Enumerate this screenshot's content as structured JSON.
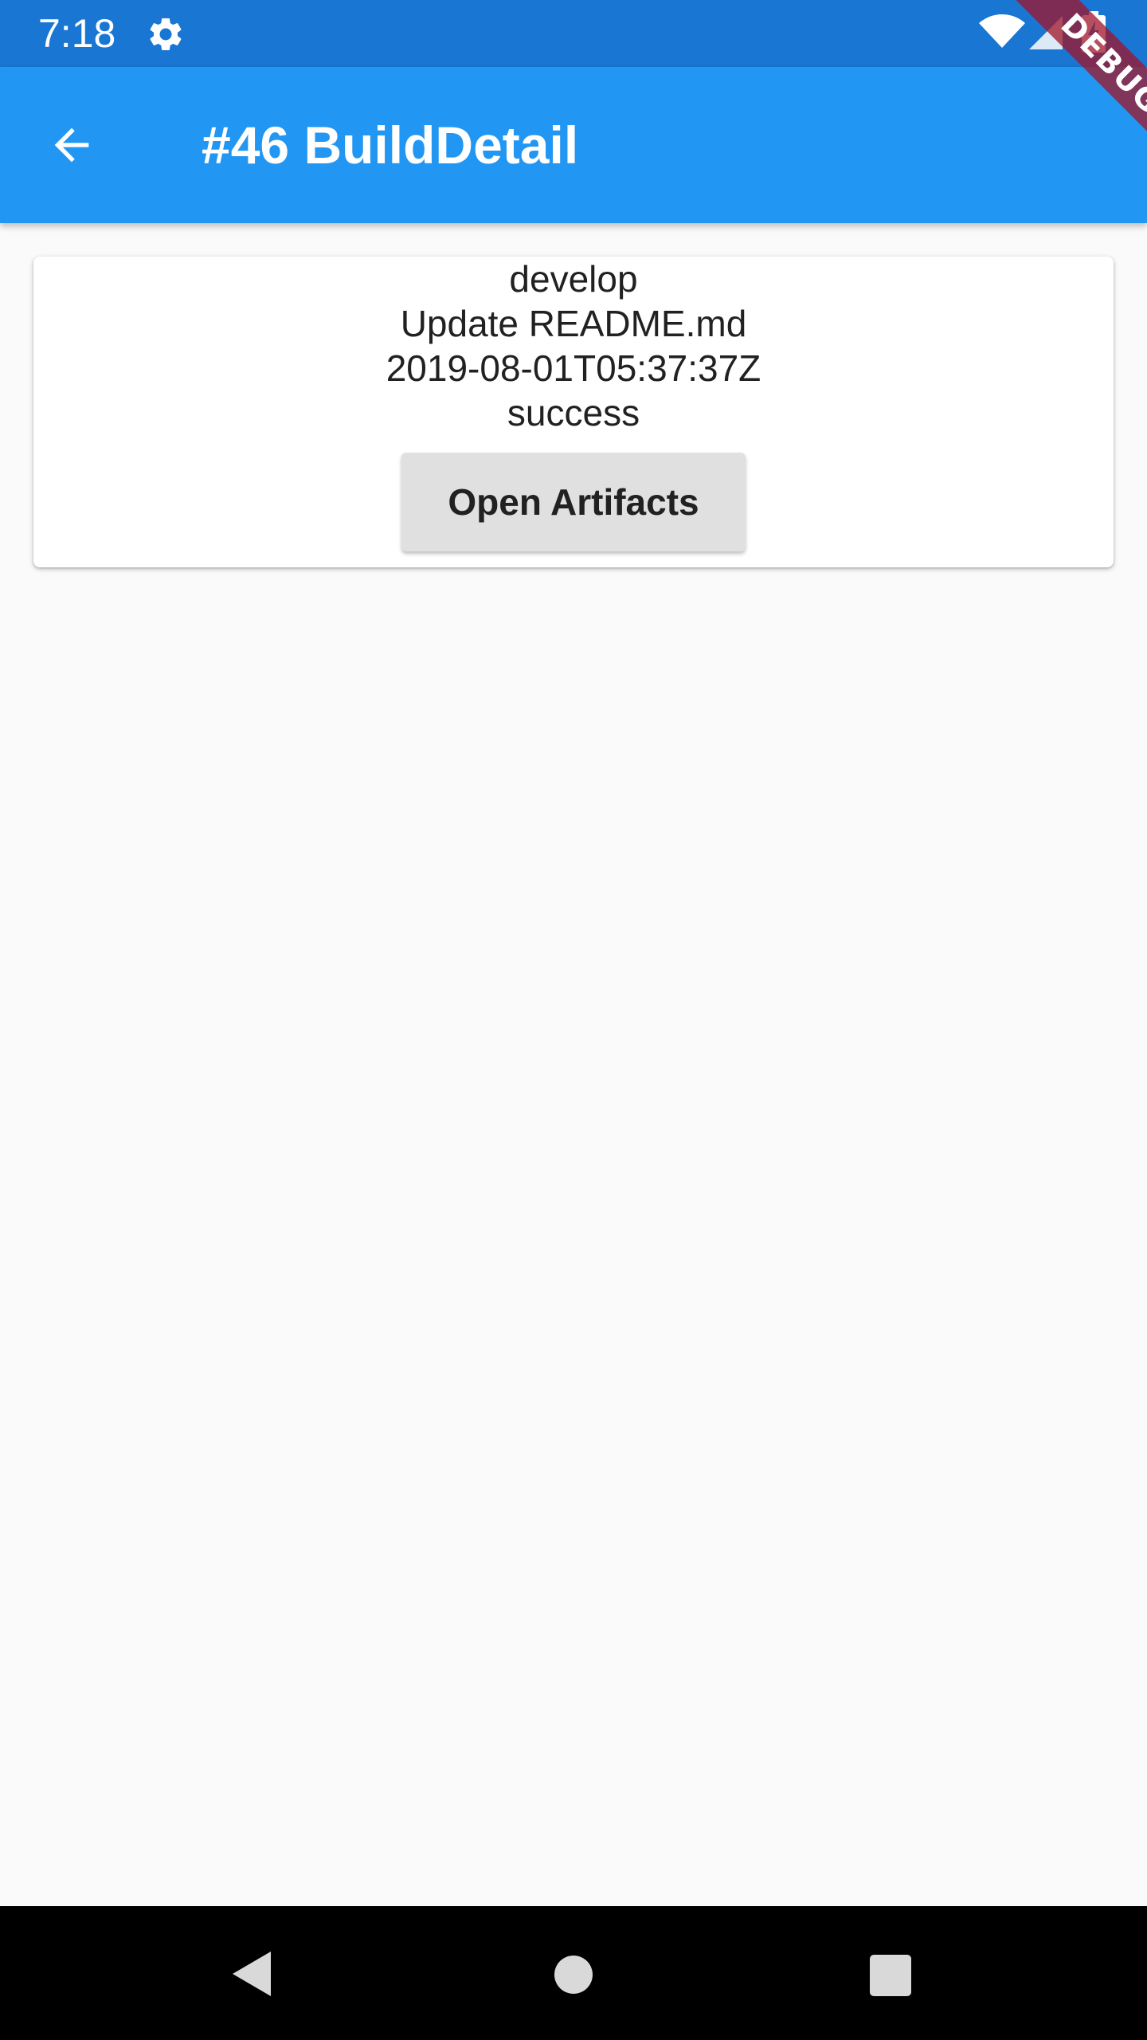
{
  "status_bar": {
    "time": "7:18",
    "icons": [
      "gear-icon",
      "wifi-icon",
      "signal-icon",
      "battery-charging-icon"
    ]
  },
  "app_bar": {
    "title": "#46 BuildDetail",
    "back_icon": "arrow-back-icon"
  },
  "debug_banner": {
    "label": "DEBUG"
  },
  "build": {
    "branch": "develop",
    "message": "Update README.md",
    "date": "2019-08-01T05:37:37Z",
    "status": "success",
    "open_artifacts_label": "Open Artifacts"
  },
  "nav_bar": {
    "icons": [
      "nav-back-icon",
      "nav-home-icon",
      "nav-recents-icon"
    ]
  },
  "colors": {
    "status_bar": "#1976d2",
    "app_bar": "#2196f3",
    "background": "#fafafa",
    "button": "#e0e0e0"
  }
}
